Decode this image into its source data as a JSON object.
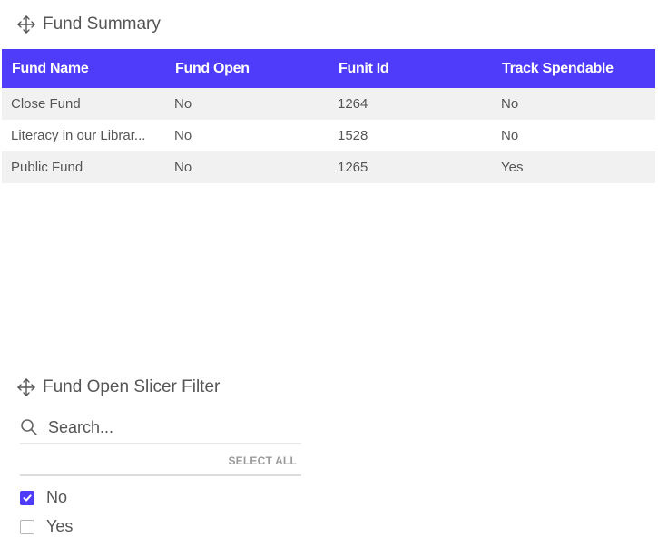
{
  "summary_panel": {
    "title": "Fund Summary",
    "columns": [
      "Fund Name",
      "Fund Open",
      "Funit Id",
      "Track Spendable"
    ],
    "rows": [
      [
        "Close Fund",
        "No",
        "1264",
        "No"
      ],
      [
        "Literacy in our Librar...",
        "No",
        "1528",
        "No"
      ],
      [
        "Public Fund",
        "No",
        "1265",
        "Yes"
      ]
    ],
    "header_color": "#4f3cfa"
  },
  "slicer_panel": {
    "title": "Fund Open Slicer Filter",
    "search_placeholder": "Search...",
    "select_all_label": "SELECT ALL",
    "options": [
      {
        "label": "No",
        "checked": true
      },
      {
        "label": "Yes",
        "checked": false
      }
    ]
  },
  "icons": [
    "move-icon",
    "search-icon",
    "checkbox-checked-icon",
    "checkbox-unchecked-icon"
  ],
  "accent_color": "#4f3cfa"
}
